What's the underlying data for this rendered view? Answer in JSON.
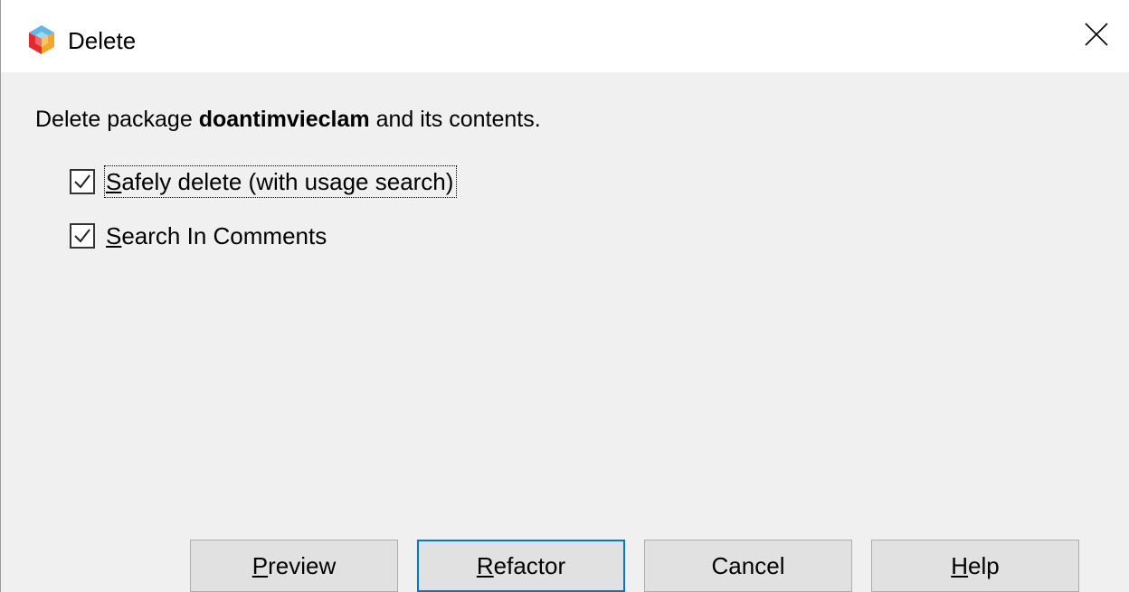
{
  "window": {
    "title": "Delete",
    "app_icon": "netbeans-cube-icon",
    "close_icon": "close-icon"
  },
  "message": {
    "prefix": "Delete package ",
    "package_name": "doantimvieclam",
    "suffix": " and its contents."
  },
  "options": [
    {
      "mnemonic": "S",
      "rest": "afely delete (with usage search)",
      "checked": true
    },
    {
      "mnemonic": "S",
      "rest": "earch In Comments",
      "checked": true
    }
  ],
  "buttons": {
    "preview": {
      "mnemonic": "P",
      "rest": "review"
    },
    "refactor": {
      "mnemonic": "R",
      "rest": "efactor"
    },
    "cancel": {
      "label": "Cancel"
    },
    "help": {
      "mnemonic": "H",
      "rest": "elp"
    }
  },
  "colors": {
    "accent": "#0078d7",
    "dialog_bg": "#f0f0f0",
    "titlebar_bg": "#ffffff"
  }
}
